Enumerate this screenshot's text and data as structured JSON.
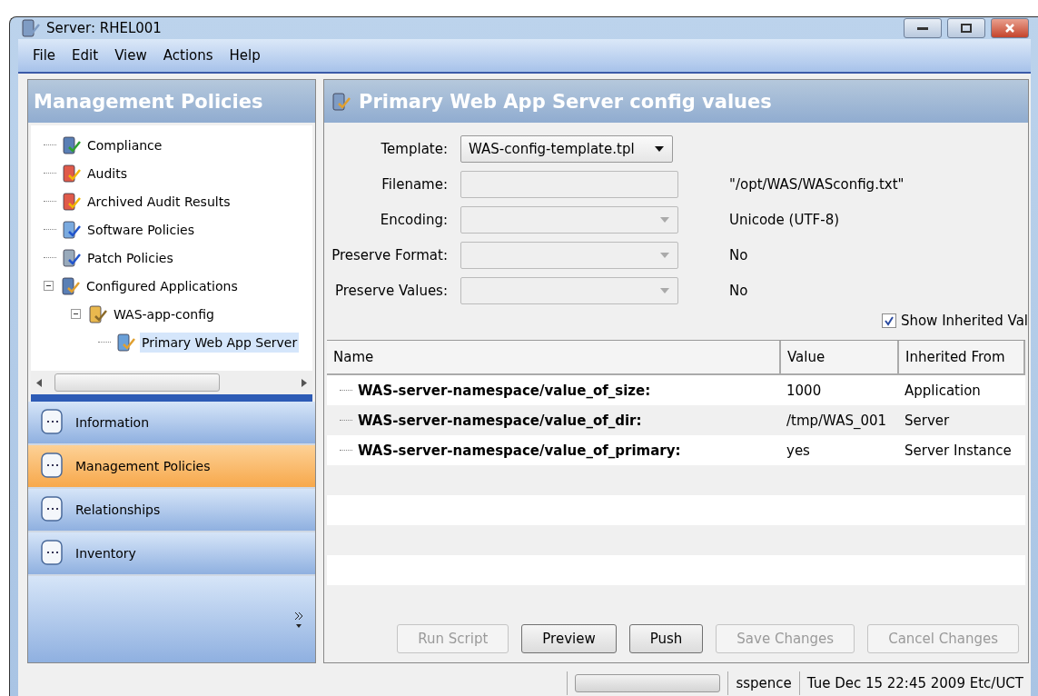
{
  "window": {
    "title": "Server: RHEL001"
  },
  "menu": [
    "File",
    "Edit",
    "View",
    "Actions",
    "Help"
  ],
  "left_panel": {
    "title": "Management Policies",
    "tree": [
      {
        "label": "Compliance",
        "selected": false
      },
      {
        "label": "Audits",
        "selected": false
      },
      {
        "label": "Archived Audit Results",
        "selected": false
      },
      {
        "label": "Software Policies",
        "selected": false
      },
      {
        "label": "Patch Policies",
        "selected": false
      },
      {
        "label": "Configured Applications",
        "selected": false,
        "expanded": true,
        "children": [
          {
            "label": "WAS-app-config",
            "selected": false,
            "expanded": true,
            "children": [
              {
                "label": "Primary Web App Server",
                "selected": true
              }
            ]
          }
        ]
      }
    ],
    "nav": [
      {
        "label": "Information",
        "selected": false
      },
      {
        "label": "Management Policies",
        "selected": true
      },
      {
        "label": "Relationships",
        "selected": false
      },
      {
        "label": "Inventory",
        "selected": false
      }
    ]
  },
  "main": {
    "title": "Primary Web App Server config values",
    "fields": [
      {
        "label": "Template:",
        "kind": "select",
        "value": "WAS-config-template.tpl",
        "disabled": false
      },
      {
        "label": "Filename:",
        "kind": "text",
        "disabled": true,
        "note": "\"/opt/WAS/WASconfig.txt\""
      },
      {
        "label": "Encoding:",
        "kind": "select",
        "disabled": true,
        "note": "Unicode (UTF-8)"
      },
      {
        "label": "Preserve Format:",
        "kind": "select",
        "disabled": true,
        "note": "No"
      },
      {
        "label": "Preserve Values:",
        "kind": "select",
        "disabled": true,
        "note": "No"
      }
    ],
    "show_inherited": {
      "label": "Show Inherited Val",
      "checked": true
    },
    "table": {
      "columns": [
        "Name",
        "Value",
        "Inherited From"
      ],
      "rows": [
        {
          "name": "WAS-server-namespace/value_of_size:",
          "value": "1000",
          "inherited_from": "Application"
        },
        {
          "name": "WAS-server-namespace/value_of_dir:",
          "value": "/tmp/WAS_001",
          "inherited_from": "Server"
        },
        {
          "name": "WAS-server-namespace/value_of_primary:",
          "value": "yes",
          "inherited_from": "Server Instance"
        }
      ]
    },
    "buttons": [
      {
        "label": "Run Script",
        "disabled": true
      },
      {
        "label": "Preview",
        "disabled": false
      },
      {
        "label": "Push",
        "disabled": false
      },
      {
        "label": "Save Changes",
        "disabled": true
      },
      {
        "label": "Cancel Changes",
        "disabled": true
      }
    ]
  },
  "status_bar": {
    "progress": {
      "level": 0
    },
    "user": "sspence",
    "datetime": "Tue Dec 15 22:45 2009 Etc/UCT"
  }
}
